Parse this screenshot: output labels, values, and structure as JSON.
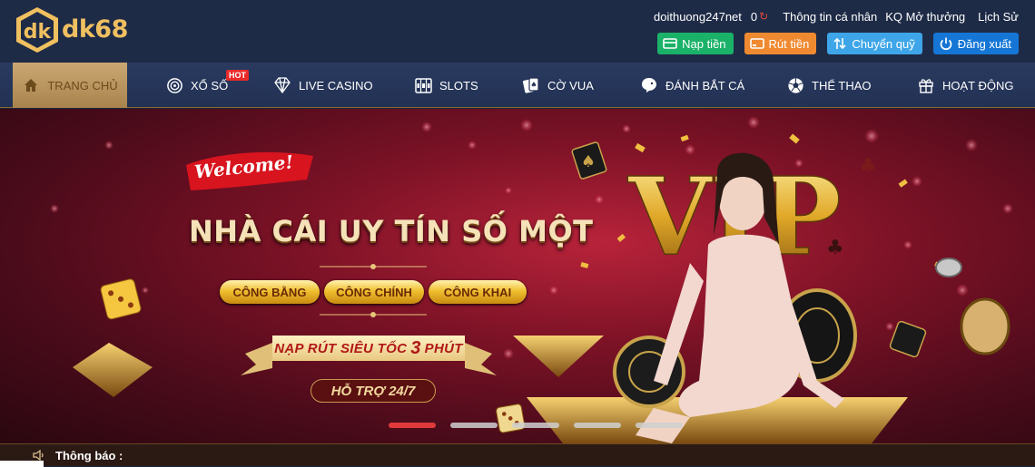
{
  "brand": {
    "logo_text": "dk68",
    "accent": "#f0c060"
  },
  "header": {
    "username": "doithuong247net",
    "balance": "0",
    "links": [
      "Thông tin cá nhân",
      "KQ Mở thưởng",
      "Lịch Sử"
    ],
    "buttons": {
      "deposit": "Nạp tiền",
      "withdraw": "Rút tiền",
      "transfer": "Chuyển quỹ",
      "logout": "Đăng xuất"
    }
  },
  "nav": {
    "items": [
      {
        "label": "TRANG CHỦ",
        "icon": "home-icon",
        "active": true
      },
      {
        "label": "XỔ SỐ",
        "icon": "lottery-icon",
        "badge": "HOT"
      },
      {
        "label": "LIVE CASINO",
        "icon": "diamond-icon"
      },
      {
        "label": "SLOTS",
        "icon": "slots-icon"
      },
      {
        "label": "CỜ VUA",
        "icon": "cards-icon"
      },
      {
        "label": "ĐÁNH BẮT CÁ",
        "icon": "fish-icon"
      },
      {
        "label": "THỂ THAO",
        "icon": "soccer-ball-icon"
      },
      {
        "label": "HOẠT ĐỘNG",
        "icon": "gift-icon"
      }
    ]
  },
  "banner": {
    "welcome": "Welcome!",
    "headline": "NHÀ CÁI UY TÍN SỐ MỘT",
    "pills": [
      "CÔNG BẰNG",
      "CÔNG CHÍNH",
      "CÔNG KHAI"
    ],
    "ribbon_prefix": "NẠP RÚT SIÊU TỐC",
    "ribbon_number": "3",
    "ribbon_suffix": "PHÚT",
    "support": "HỖ TRỢ 24/7",
    "vip": "VIP",
    "slides": 5,
    "active_slide": 1
  },
  "notice": {
    "label": "Thông báo :"
  }
}
